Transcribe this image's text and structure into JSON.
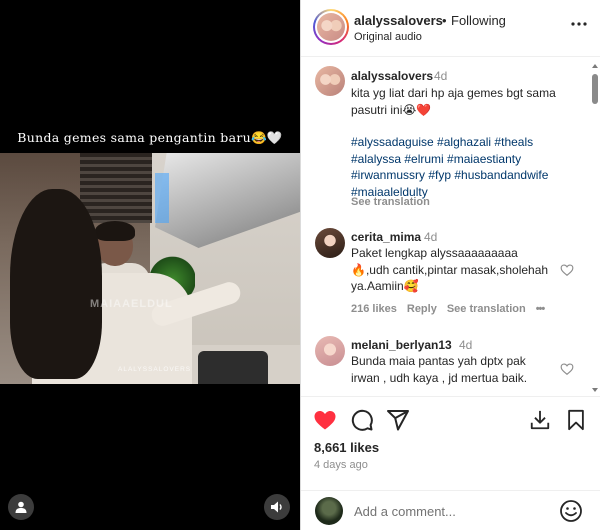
{
  "video": {
    "caption": "Bunda gemes sama pengantin baru😂🤍",
    "watermark": "MAIAAELDUL",
    "brand": "ALALYSSALOVERS"
  },
  "header": {
    "username": "alalyssalovers",
    "separator": "•",
    "follow_status": "Following",
    "audio": "Original audio",
    "more_icon": "more-horizontal-icon"
  },
  "post": {
    "username": "alalyssalovers",
    "time": "4d",
    "text": "kita yg liat dari hp aja gemes bgt sama pasutri ini😭❤️",
    "hashtags_line1": "#alyssadaguise #alghazali #theals",
    "hashtags_line2": "#alalyssa #elrumi #maiaestianty",
    "hashtags_line3": "#irwanmussry #fyp #husbandandwife",
    "hashtags_line4": "#maiaaleldulty",
    "see_translation": "See translation"
  },
  "comments": [
    {
      "username": "cerita_mima",
      "time": "4d",
      "line1": "Paket lengkap alyssaaaaaaaaa",
      "line2": "🔥,udh cantik,pintar masak,sholehah",
      "line3": "ya.Aamiin🥰",
      "likes": "216 likes",
      "reply": "Reply",
      "see_translation": "See translation",
      "more": "•••"
    },
    {
      "username": "melani_berlyan13",
      "time": "4d",
      "line1": "Bunda maia pantas yah dptx pak",
      "line2": "irwan , udh kaya , jd mertua baik."
    }
  ],
  "actions": {
    "like_icon": "heart-filled-icon",
    "comment_icon": "comment-icon",
    "share_icon": "share-icon",
    "download_icon": "download-icon",
    "save_icon": "bookmark-icon",
    "like_color": "#ff3040"
  },
  "stats": {
    "likes": "8,661 likes",
    "date": "4 days ago"
  },
  "add_comment": {
    "placeholder": "Add a comment...",
    "emoji_icon": "smiley-icon"
  }
}
